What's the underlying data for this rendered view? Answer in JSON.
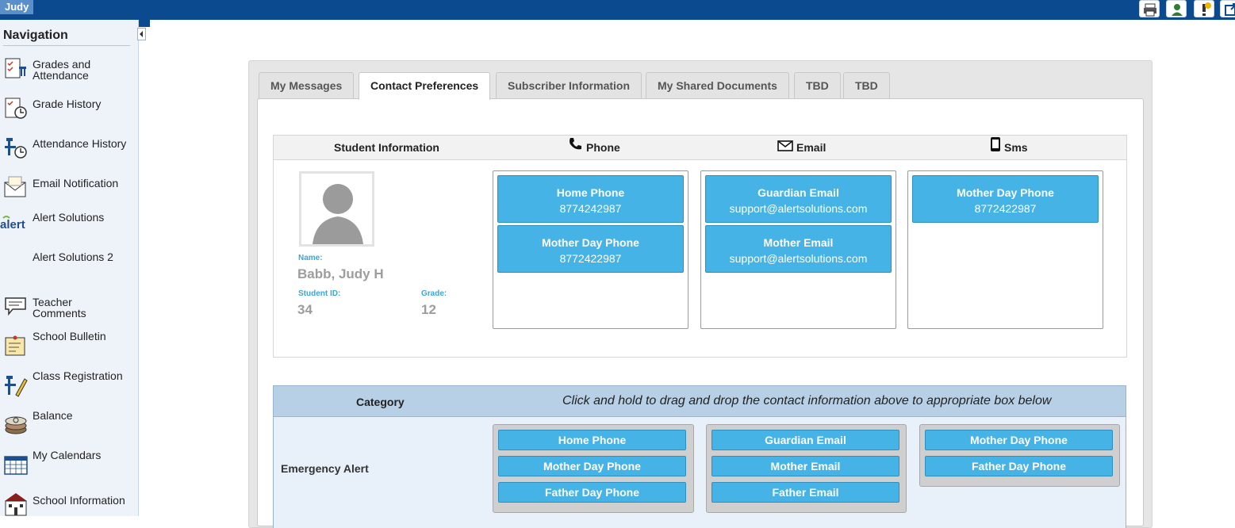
{
  "topbar": {
    "user": "Judy"
  },
  "sidebar": {
    "title": "Navigation",
    "items": [
      {
        "label": "Grades and Attendance",
        "icon": "gradebook-icon"
      },
      {
        "label": "Grade History",
        "icon": "grade-history-icon"
      },
      {
        "label": "Attendance History",
        "icon": "attendance-history-icon"
      },
      {
        "label": "Email Notification",
        "icon": "envelope-icon"
      },
      {
        "label": "Alert Solutions",
        "icon": "alert-logo-icon"
      },
      {
        "label": "Alert Solutions 2",
        "icon": ""
      },
      {
        "label": "Teacher Comments",
        "icon": "comment-icon"
      },
      {
        "label": "School Bulletin",
        "icon": "bulletin-icon"
      },
      {
        "label": "Class Registration",
        "icon": "registration-icon"
      },
      {
        "label": "Balance",
        "icon": "coins-icon"
      },
      {
        "label": "My Calendars",
        "icon": "calendar-icon"
      },
      {
        "label": "School Information",
        "icon": "school-icon"
      }
    ]
  },
  "tabs": [
    {
      "label": "My Messages",
      "active": false
    },
    {
      "label": "Contact Preferences",
      "active": true
    },
    {
      "label": "Subscriber Information",
      "active": false
    },
    {
      "label": "My Shared Documents",
      "active": false
    },
    {
      "label": "TBD",
      "active": false
    },
    {
      "label": "TBD",
      "active": false
    }
  ],
  "info": {
    "headers": {
      "student": "Student Information",
      "phone": "Phone",
      "email": "Email",
      "sms": "Sms"
    },
    "student": {
      "name_label": "Name:",
      "name": "Babb, Judy H",
      "id_label": "Student ID:",
      "id": "34",
      "grade_label": "Grade:",
      "grade": "12"
    },
    "phone_cards": [
      {
        "title": "Home Phone",
        "value": "8774242987"
      },
      {
        "title": "Mother Day Phone",
        "value": "8772422987"
      }
    ],
    "email_cards": [
      {
        "title": "Guardian Email",
        "value": "support@alertsolutions.com"
      },
      {
        "title": "Mother Email",
        "value": "support@alertsolutions.com"
      }
    ],
    "sms_cards": [
      {
        "title": "Mother Day Phone",
        "value": "8772422987"
      }
    ]
  },
  "category": {
    "header": "Category",
    "instruction": "Click and hold to drag and drop the contact information above to appropriate box below",
    "rows": [
      {
        "label": "Emergency Alert",
        "phone": [
          "Home Phone",
          "Mother Day Phone",
          "Father Day Phone"
        ],
        "email": [
          "Guardian Email",
          "Mother Email",
          "Father Email"
        ],
        "sms": [
          "Mother Day Phone",
          "Father Day Phone"
        ]
      }
    ]
  },
  "colors": {
    "topbar": "#0b4a8e",
    "card": "#46b3e6",
    "label_blue": "#3aa6dd",
    "category_header": "#b8d0e6",
    "category_row": "#e8f1fa"
  }
}
